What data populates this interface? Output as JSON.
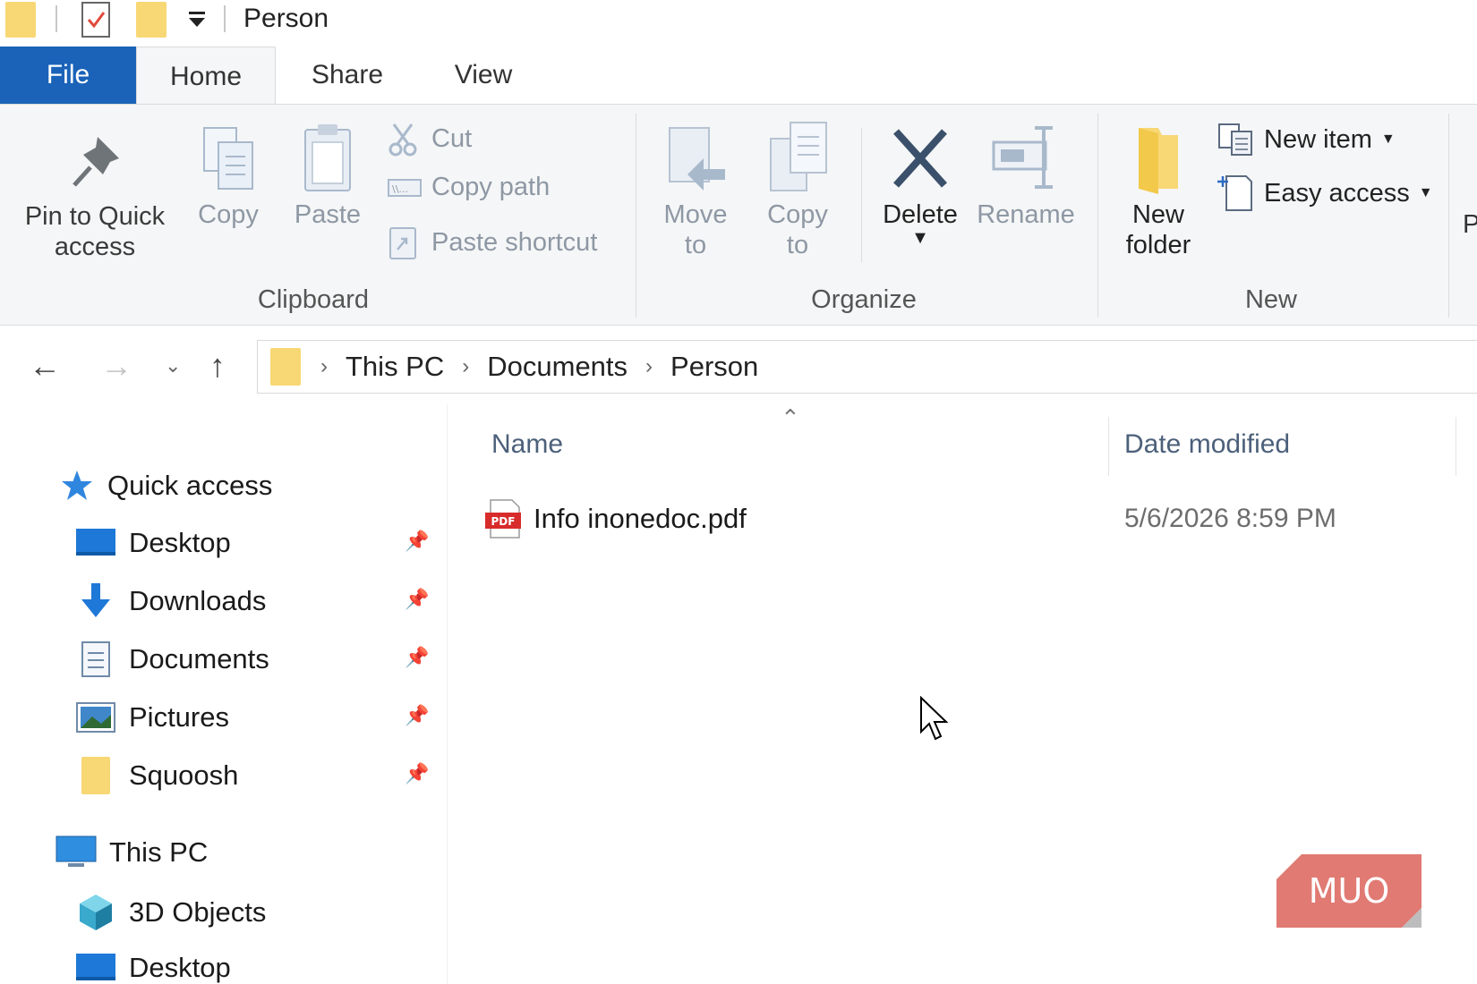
{
  "window": {
    "title": "Person"
  },
  "tabs": {
    "file": "File",
    "home": "Home",
    "share": "Share",
    "view": "View"
  },
  "ribbon": {
    "clipboard": {
      "label": "Clipboard",
      "pin_line1": "Pin to Quick",
      "pin_line2": "access",
      "copy": "Copy",
      "paste": "Paste",
      "cut": "Cut",
      "copy_path": "Copy path",
      "paste_shortcut": "Paste shortcut"
    },
    "organize": {
      "label": "Organize",
      "move_line1": "Move",
      "move_line2": "to",
      "copy_line1": "Copy",
      "copy_line2": "to",
      "delete": "Delete",
      "rename": "Rename"
    },
    "new": {
      "label": "New",
      "new_folder_line1": "New",
      "new_folder_line2": "folder",
      "new_item": "New item",
      "easy_access": "Easy access"
    }
  },
  "address": {
    "crumbs": [
      "This PC",
      "Documents",
      "Person"
    ]
  },
  "navpane": {
    "quick_access": "Quick access",
    "items": [
      "Desktop",
      "Downloads",
      "Documents",
      "Pictures",
      "Squoosh"
    ],
    "this_pc": "This PC",
    "pc_items": [
      "3D Objects",
      "Desktop"
    ]
  },
  "columns": {
    "name": "Name",
    "date_modified": "Date modified"
  },
  "files": [
    {
      "name": "Info inonedoc.pdf",
      "date": "5/6/2026 8:59 PM",
      "icon_text": "PDF"
    }
  ],
  "watermark": {
    "text": "MUO"
  },
  "colors": {
    "accent": "#1a63b8",
    "folder": "#f8d775",
    "pdf_red": "#d82b2b",
    "watermark": "#e07a73"
  }
}
